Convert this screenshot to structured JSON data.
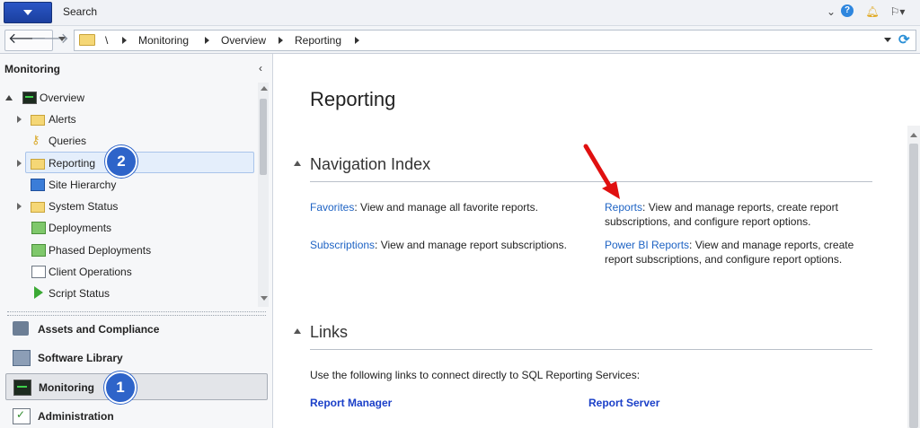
{
  "topbar": {
    "search_label": "Search",
    "icons": [
      "menu-icon",
      "collapse-icon",
      "help-icon",
      "bell-icon",
      "feedback-icon"
    ]
  },
  "address": {
    "crumbs": [
      "\\",
      "Monitoring",
      "Overview",
      "Reporting"
    ]
  },
  "left_pane": {
    "title": "Monitoring",
    "tree": [
      {
        "label": "Overview",
        "icon": "monitor-icon"
      },
      {
        "label": "Alerts",
        "icon": "folder-icon"
      },
      {
        "label": "Queries",
        "icon": "key-icon"
      },
      {
        "label": "Reporting",
        "icon": "folder-icon",
        "selected": true
      },
      {
        "label": "Site Hierarchy",
        "icon": "hierarchy-icon"
      },
      {
        "label": "System Status",
        "icon": "folder-icon"
      },
      {
        "label": "Deployments",
        "icon": "deployment-icon"
      },
      {
        "label": "Phased Deployments",
        "icon": "deployment-icon"
      },
      {
        "label": "Client Operations",
        "icon": "client-icon"
      },
      {
        "label": "Script Status",
        "icon": "play-icon"
      }
    ],
    "workspaces": [
      {
        "label": "Assets and Compliance"
      },
      {
        "label": "Software Library"
      },
      {
        "label": "Monitoring",
        "selected": true
      },
      {
        "label": "Administration"
      }
    ]
  },
  "badges": {
    "one": "1",
    "two": "2"
  },
  "content": {
    "title": "Reporting",
    "nav_index": {
      "title": "Navigation Index",
      "items": [
        {
          "link": "Favorites",
          "text": ": View and manage all favorite reports."
        },
        {
          "link": "Reports",
          "text": ": View and manage reports, create report subscriptions, and configure report options."
        },
        {
          "link": "Subscriptions",
          "text": ": View and manage report subscriptions."
        },
        {
          "link": "Power BI Reports",
          "text": ": View and manage reports, create report subscriptions, and configure report options."
        }
      ]
    },
    "links": {
      "title": "Links",
      "intro": "Use the following links to connect directly to SQL Reporting Services:",
      "report_manager": "Report Manager",
      "report_server": "Report Server"
    }
  },
  "colors": {
    "accent": "#2e64c9",
    "link": "#1e63c4",
    "annotation_arrow": "#e01010"
  }
}
